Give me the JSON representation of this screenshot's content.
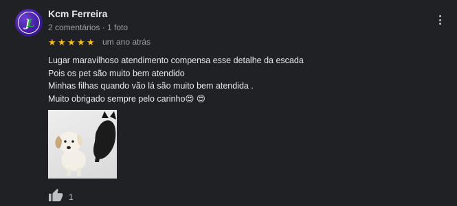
{
  "review": {
    "author_name": "Kcm Ferreira",
    "author_meta": "2 comentários · 1 foto",
    "rating": 5,
    "time_ago": "um ano atrás",
    "text_lines": [
      "Lugar maravilhoso atendimento compensa esse detalhe da escada",
      "Pois os pet são muito bem atendido",
      "Minhas filhas quando vão lá são muito bem atendida .",
      "Muito obrigado sempre pelo carinho😍 😍"
    ],
    "like_count": "1",
    "avatar_initials": "JL"
  },
  "colors": {
    "background": "#202124",
    "star": "#fbbc04",
    "text_primary": "#e8eaed",
    "text_secondary": "#9aa0a6"
  },
  "icons": {
    "more": "more-vert-icon",
    "like": "thumb-up-icon",
    "star": "star-icon"
  }
}
